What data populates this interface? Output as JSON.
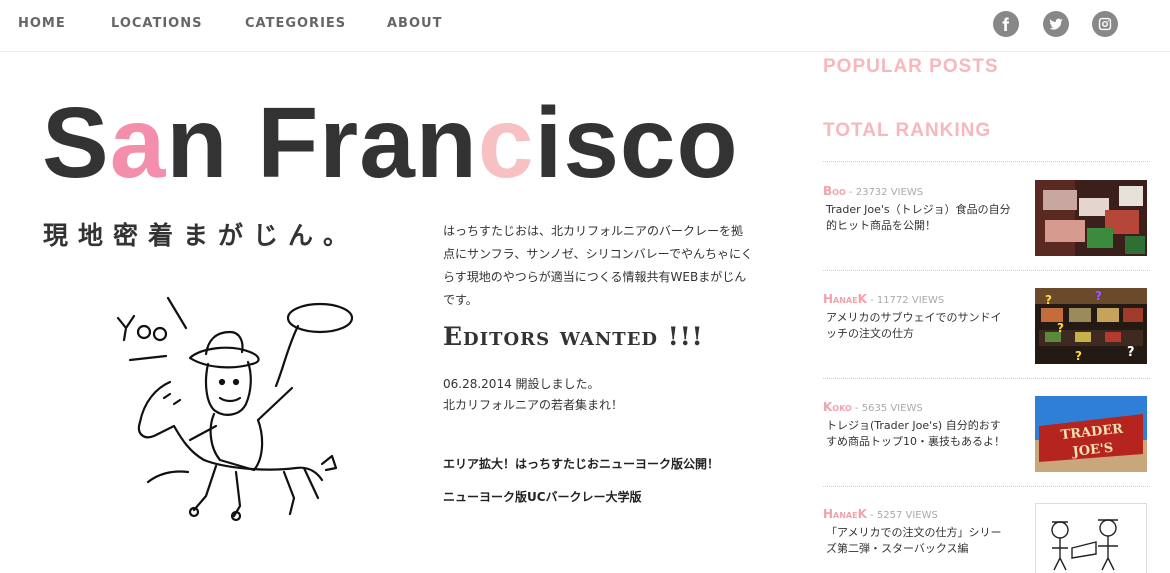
{
  "nav": {
    "items": [
      "HOME",
      "LOCATIONS",
      "CATEGORIES",
      "ABOUT"
    ],
    "social": [
      "facebook-icon",
      "twitter-icon",
      "instagram-icon"
    ]
  },
  "hero": {
    "title_parts": [
      "S",
      "a",
      "n Fran",
      "c",
      "isco"
    ],
    "tagline": "現地密着まがじん。"
  },
  "intro": {
    "text": "はっちすたじおは、北カリフォルニアのバークレーを拠点にサンフラ、サンノゼ、シリコンバレーでやんちゃにくらす現地のやつらが適当につくる情報共有WEBまがじんです。"
  },
  "editors": {
    "label": "Editors wanted !!!"
  },
  "news": {
    "line1": "06.28.2014 開設しました。",
    "line2": "北カリフォルニアの若者集まれ！"
  },
  "links": {
    "ny": "エリア拡大！はっちすたじおニューヨーク版公開！",
    "ucb": "ニューヨーク版UCバークレー大学版"
  },
  "sidebar": {
    "popular_heading": "POPULAR POSTS",
    "ranking_heading": "TOTAL RANKING",
    "ranking": [
      {
        "author": "Boo",
        "views": " - 23732 VIEWS",
        "title": "Trader Joe's（トレジョ）食品の自分的ヒット商品を公開！"
      },
      {
        "author": "HanaeK",
        "views": " - 11772 VIEWS",
        "title": "アメリカのサブウェイでのサンドイッチの注文の仕方"
      },
      {
        "author": "Koko",
        "views": " - 5635 VIEWS",
        "title": "トレジョ(Trader Joe's) 自分的おすすめ商品トップ10・裏技もあるよ！"
      },
      {
        "author": "HanaeK",
        "views": " - 5257 VIEWS",
        "title": "「アメリカでの注文の仕方」シリーズ第二弾・スターバックス編"
      }
    ],
    "thumb3_text": [
      "TRADER",
      "JOE'S"
    ]
  },
  "colors": {
    "accent_pink": "#f38fab",
    "pale_pink": "#f7c0c3",
    "sidebar_heading": "#f7b7bd",
    "text": "#333333"
  }
}
